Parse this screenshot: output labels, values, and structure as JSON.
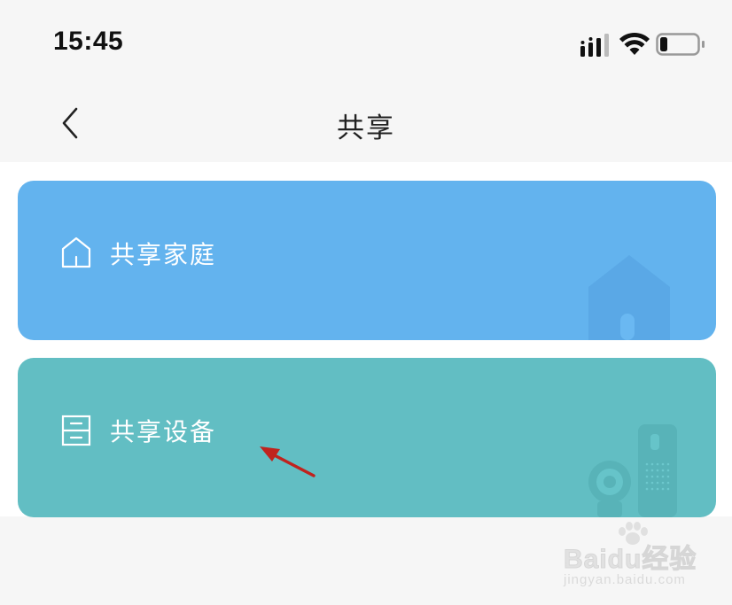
{
  "status_bar": {
    "time": "15:45",
    "icons": [
      "cellular-signal-icon",
      "wifi-icon",
      "battery-icon"
    ],
    "battery_level": 0.2
  },
  "nav": {
    "back_icon": "chevron-left-icon",
    "title": "共享"
  },
  "cards": [
    {
      "label": "共享家庭",
      "icon": "house-outline-icon",
      "color": "#63b3ee"
    },
    {
      "label": "共享设备",
      "icon": "device-outline-icon",
      "color": "#62bec3"
    }
  ],
  "colors": {
    "page_background": "#f6f6f6",
    "content_background": "#ffffff",
    "annotation_arrow": "#c0231e"
  },
  "watermark": {
    "main": "Baidu经验",
    "sub": "jingyan.baidu.com"
  }
}
